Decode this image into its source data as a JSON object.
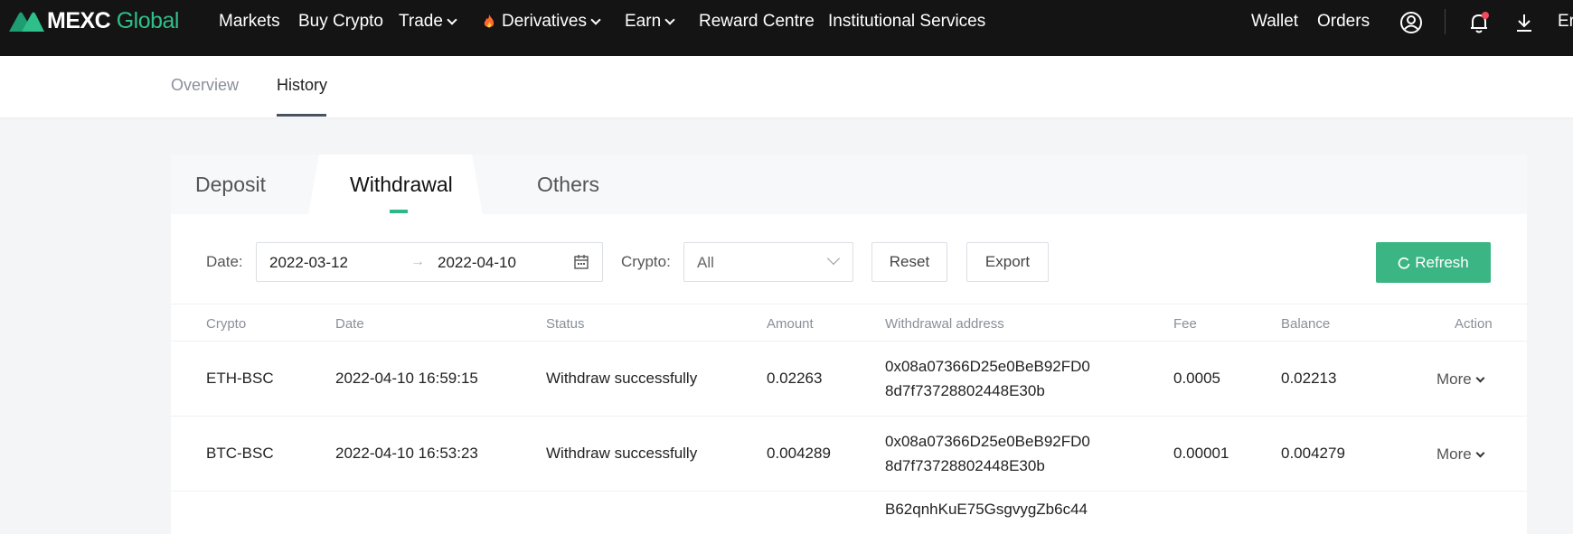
{
  "brand": {
    "logo_main": "MEXC",
    "logo_sub": "Global",
    "accent": "#2fbf8a"
  },
  "nav": {
    "items": [
      "Markets",
      "Buy Crypto",
      "Trade",
      "Derivatives",
      "Earn",
      "Reward Centre",
      "Institutional Services"
    ],
    "right": [
      "Wallet",
      "Orders"
    ],
    "lang_partial": "Er"
  },
  "subnav": {
    "tabs": [
      "Overview",
      "History"
    ],
    "active": "History"
  },
  "history_tabs": {
    "tabs": [
      "Deposit",
      "Withdrawal",
      "Others"
    ],
    "active": "Withdrawal"
  },
  "filters": {
    "date_label": "Date",
    "date_sep": ":",
    "date_start": "2022-03-12",
    "date_end": "2022-04-10",
    "arrow": "→",
    "crypto_label": "Crypto",
    "crypto_value": "All",
    "reset": "Reset",
    "export": "Export",
    "refresh": "Refresh"
  },
  "table": {
    "columns": [
      "Crypto",
      "Date",
      "Status",
      "Amount",
      "Withdrawal address",
      "Fee",
      "Balance",
      "Action"
    ],
    "rows": [
      {
        "crypto": "ETH-BSC",
        "date": "2022-04-10 16:59:15",
        "status": "Withdraw successfully",
        "amount": "0.02263",
        "address_1": "0x08a07366D25e0BeB92FD0",
        "address_2": "8d7f73728802448E30b",
        "fee": "0.0005",
        "balance": "0.02213",
        "action": "More"
      },
      {
        "crypto": "BTC-BSC",
        "date": "2022-04-10 16:53:23",
        "status": "Withdraw successfully",
        "amount": "0.004289",
        "address_1": "0x08a07366D25e0BeB92FD0",
        "address_2": "8d7f73728802448E30b",
        "fee": "0.00001",
        "balance": "0.004279",
        "action": "More"
      },
      {
        "address_1": "B62qnhKuE75GsgvygZb6c44"
      }
    ]
  }
}
